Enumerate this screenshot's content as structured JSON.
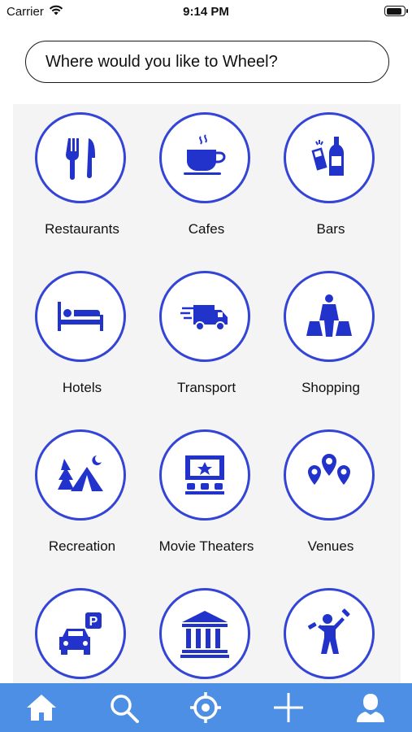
{
  "status_bar": {
    "carrier": "Carrier",
    "time": "9:14 PM",
    "battery_level": 0.9
  },
  "search": {
    "placeholder": "Where would you like to Wheel?"
  },
  "categories": [
    {
      "label": "Restaurants",
      "icon": "fork-knife-icon"
    },
    {
      "label": "Cafes",
      "icon": "coffee-cup-icon"
    },
    {
      "label": "Bars",
      "icon": "drinks-icon"
    },
    {
      "label": "Hotels",
      "icon": "bed-icon"
    },
    {
      "label": "Transport",
      "icon": "truck-icon"
    },
    {
      "label": "Shopping",
      "icon": "shopping-bags-icon"
    },
    {
      "label": "Recreation",
      "icon": "tent-icon"
    },
    {
      "label": "Movie Theaters",
      "icon": "theater-icon"
    },
    {
      "label": "Venues",
      "icon": "map-pins-icon"
    },
    {
      "label": "",
      "icon": "parking-car-icon"
    },
    {
      "label": "",
      "icon": "museum-icon"
    },
    {
      "label": "",
      "icon": "fitness-icon"
    }
  ],
  "tab_bar": {
    "items": [
      {
        "name": "home",
        "icon": "home-icon"
      },
      {
        "name": "search",
        "icon": "search-icon"
      },
      {
        "name": "locate",
        "icon": "target-icon"
      },
      {
        "name": "add",
        "icon": "plus-icon"
      },
      {
        "name": "profile",
        "icon": "user-icon"
      }
    ]
  },
  "colors": {
    "accent": "#3344d6",
    "tab_bar": "#4d8fe4",
    "panel": "#f4f4f4"
  }
}
